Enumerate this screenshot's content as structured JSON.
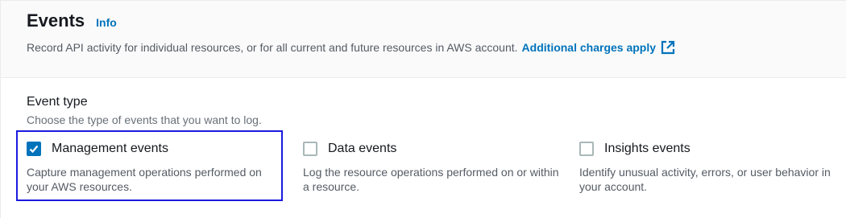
{
  "section": {
    "title": "Events",
    "info_label": "Info",
    "description": "Record API activity for individual resources, or for all current and future resources in AWS account.",
    "charges_link": "Additional charges apply"
  },
  "event_type": {
    "label": "Event type",
    "description": "Choose the type of events that you want to log.",
    "options": [
      {
        "label": "Management events",
        "description": "Capture management operations performed on your AWS resources.",
        "checked": true
      },
      {
        "label": "Data events",
        "description": "Log the resource operations performed on or within a resource.",
        "checked": false
      },
      {
        "label": "Insights events",
        "description": "Identify unusual activity, errors, or user behavior in your account.",
        "checked": false
      }
    ]
  },
  "icons": {
    "external_link": "external-link-icon",
    "checkmark": "checkmark-icon"
  },
  "colors": {
    "link": "#0073bb",
    "checkbox_checked": "#0073bb",
    "highlight_border": "#1a1ae0"
  }
}
